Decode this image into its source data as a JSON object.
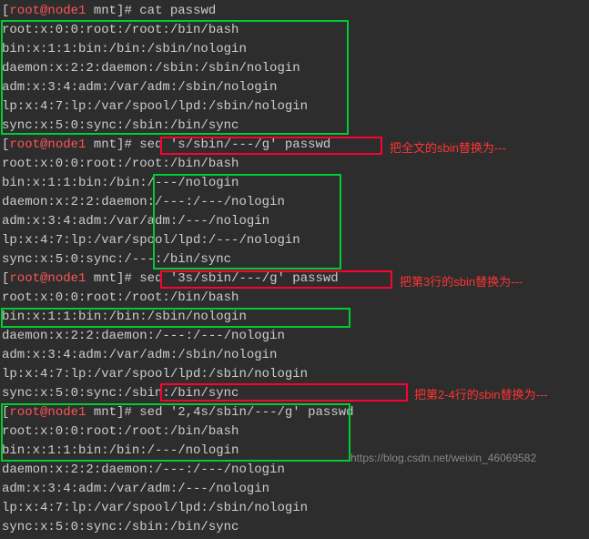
{
  "prompts": {
    "user_host": "root@node1",
    "path": "mnt",
    "symbol": "#"
  },
  "commands": {
    "cat": "cat passwd",
    "sed1": "sed 's/sbin/---/g' passwd",
    "sed2": "sed '3s/sbin/---/g' passwd",
    "sed3": "sed '2,4s/sbin/---/g' passwd"
  },
  "output_block1": [
    "root:x:0:0:root:/root:/bin/bash",
    "bin:x:1:1:bin:/bin:/sbin/nologin",
    "daemon:x:2:2:daemon:/sbin:/sbin/nologin",
    "adm:x:3:4:adm:/var/adm:/sbin/nologin",
    "lp:x:4:7:lp:/var/spool/lpd:/sbin/nologin",
    "sync:x:5:0:sync:/sbin:/bin/sync"
  ],
  "output_block2": [
    "root:x:0:0:root:/root:/bin/bash",
    "bin:x:1:1:bin:/bin:/---/nologin",
    "daemon:x:2:2:daemon:/---:/---/nologin",
    "adm:x:3:4:adm:/var/adm:/---/nologin",
    "lp:x:4:7:lp:/var/spool/lpd:/---/nologin",
    "sync:x:5:0:sync:/---:/bin/sync"
  ],
  "output_block3": [
    "root:x:0:0:root:/root:/bin/bash",
    "bin:x:1:1:bin:/bin:/sbin/nologin",
    "daemon:x:2:2:daemon:/---:/---/nologin",
    "adm:x:3:4:adm:/var/adm:/sbin/nologin",
    "lp:x:4:7:lp:/var/spool/lpd:/sbin/nologin",
    "sync:x:5:0:sync:/sbin:/bin/sync"
  ],
  "output_block4": [
    "root:x:0:0:root:/root:/bin/bash",
    "bin:x:1:1:bin:/bin:/---/nologin",
    "daemon:x:2:2:daemon:/---:/---/nologin",
    "adm:x:3:4:adm:/var/adm:/---/nologin",
    "lp:x:4:7:lp:/var/spool/lpd:/sbin/nologin",
    "sync:x:5:0:sync:/sbin:/bin/sync"
  ],
  "annotations": {
    "ann1": "把全文的sbin替换为---",
    "ann2": "把第3行的sbin替换为---",
    "ann3": "把第2-4行的sbin替换为---"
  },
  "watermark": "https://blog.csdn.net/weixin_46069582"
}
